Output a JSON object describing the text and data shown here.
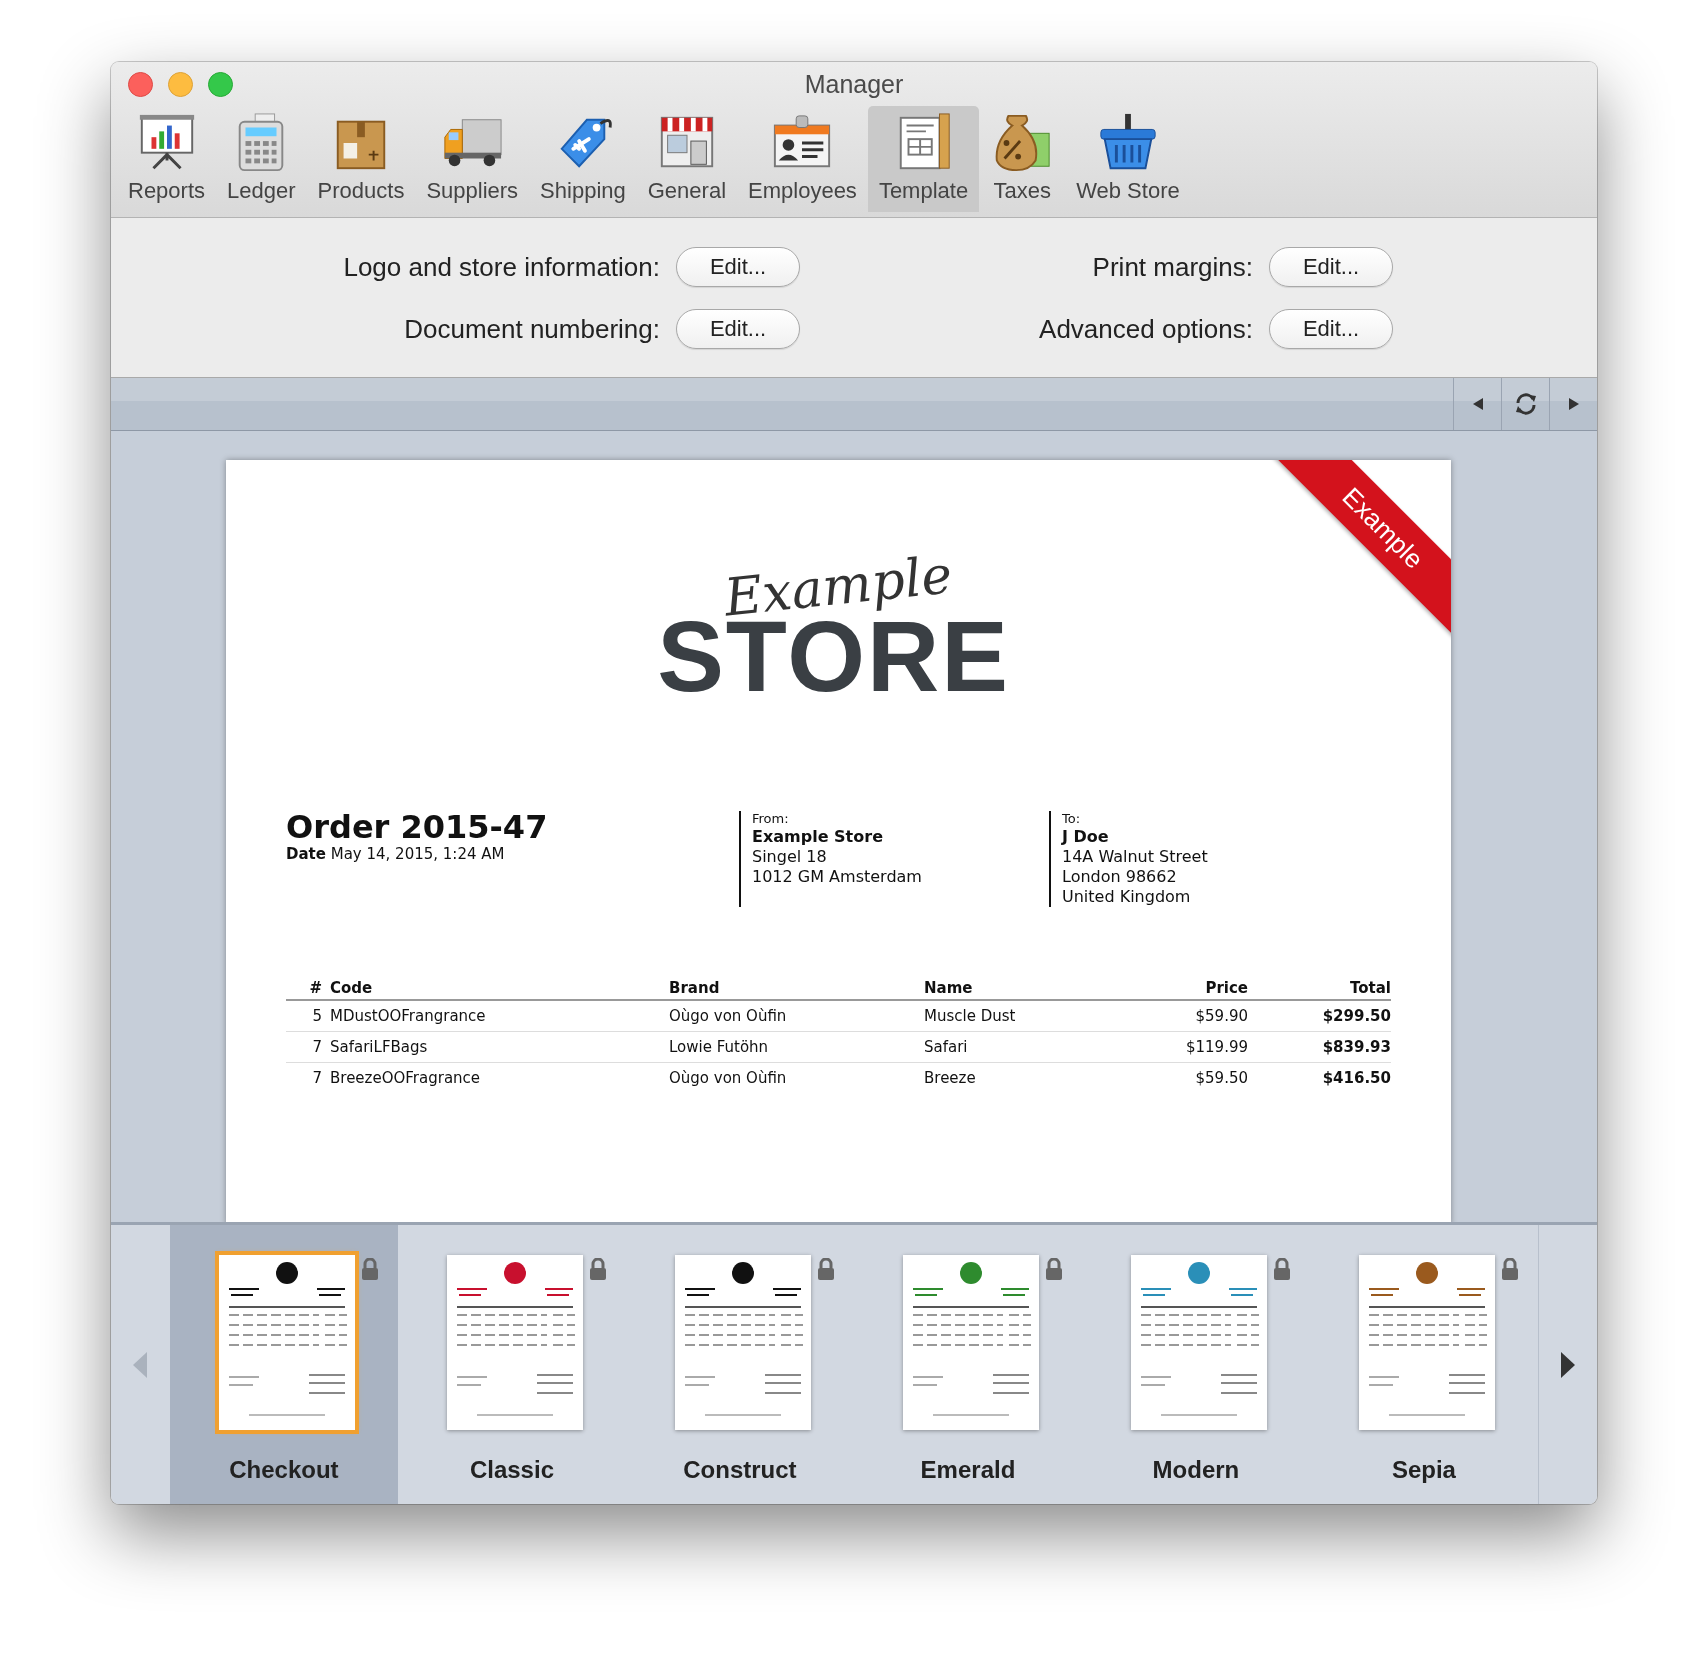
{
  "window": {
    "title": "Manager"
  },
  "toolbar": {
    "items": [
      {
        "label": "Reports",
        "selected": false
      },
      {
        "label": "Ledger",
        "selected": false
      },
      {
        "label": "Products",
        "selected": false
      },
      {
        "label": "Suppliers",
        "selected": false
      },
      {
        "label": "Shipping",
        "selected": false
      },
      {
        "label": "General",
        "selected": false
      },
      {
        "label": "Employees",
        "selected": false
      },
      {
        "label": "Template",
        "selected": true
      },
      {
        "label": "Taxes",
        "selected": false
      },
      {
        "label": "Web Store",
        "selected": false
      }
    ]
  },
  "settings": [
    {
      "label": "Logo and store information:",
      "button": "Edit..."
    },
    {
      "label": "Print margins:",
      "button": "Edit..."
    },
    {
      "label": "Document numbering:",
      "button": "Edit..."
    },
    {
      "label": "Advanced options:",
      "button": "Edit..."
    }
  ],
  "document": {
    "ribbon": "Example",
    "logo": {
      "script": "Example",
      "wordmark": "STORE"
    },
    "order": {
      "title": "Order 2015-47",
      "date": "**Date** May 14, 2015, 1:24 AM"
    },
    "from": {
      "label": "From:",
      "name": "Example Store",
      "lines": [
        "Singel 18",
        "1012 GM Amsterdam"
      ]
    },
    "to": {
      "label": "To:",
      "name": "J Doe",
      "lines": [
        "14A Walnut Street",
        "London 98662",
        "United Kingdom"
      ]
    },
    "table": {
      "columns": [
        "#",
        "Code",
        "Brand",
        "Name",
        "Price",
        "Total"
      ],
      "rows": [
        [
          "5",
          "MDustOOFrangrance",
          "Oùgo von Oùfin",
          "Muscle Dust",
          "$59.90",
          "$299.50"
        ],
        [
          "7",
          "SafariLFBags",
          "Lowie Futöhn",
          "Safari",
          "$119.99",
          "$839.93"
        ],
        [
          "7",
          "BreezeOOFragrance",
          "Oùgo von Oùfin",
          "Breeze",
          "$59.50",
          "$416.50"
        ]
      ]
    }
  },
  "templates": {
    "scroll_left_enabled": false,
    "scroll_right_enabled": true,
    "items": [
      {
        "name": "Checkout",
        "selected": true,
        "locked": true,
        "color": "#111111"
      },
      {
        "name": "Classic",
        "selected": false,
        "locked": true,
        "color": "#c8102e"
      },
      {
        "name": "Construct",
        "selected": false,
        "locked": true,
        "color": "#111111"
      },
      {
        "name": "Emerald",
        "selected": false,
        "locked": true,
        "color": "#2e8b2e"
      },
      {
        "name": "Modern",
        "selected": false,
        "locked": true,
        "color": "#2a8fb8"
      },
      {
        "name": "Sepia",
        "selected": false,
        "locked": true,
        "color": "#9a5a1e"
      }
    ]
  }
}
